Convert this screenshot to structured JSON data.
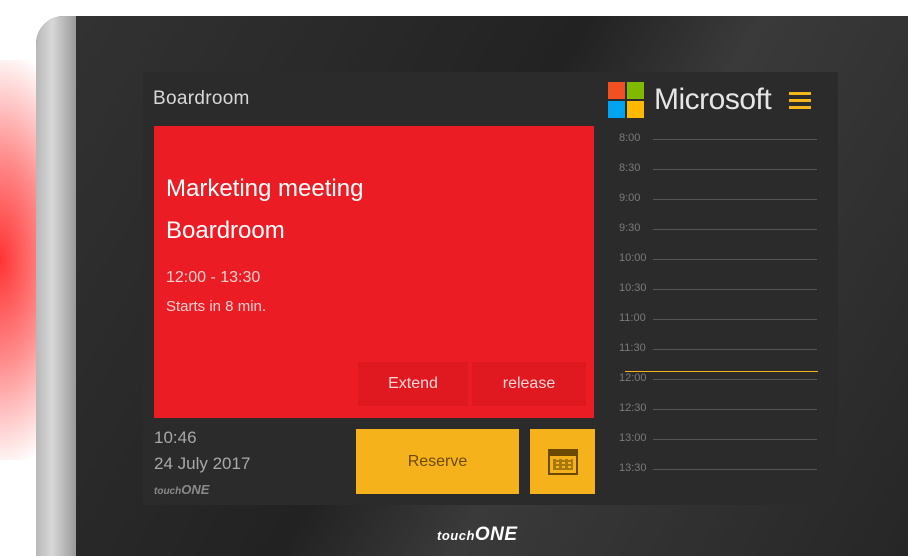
{
  "room": {
    "title": "Boardroom"
  },
  "brand": {
    "name": "Microsoft",
    "logo_colors": [
      "#f25022",
      "#7fba00",
      "#00a4ef",
      "#ffb900"
    ],
    "menu_icon": "hamburger-icon"
  },
  "meeting": {
    "title": "Marketing meeting",
    "location": "Boardroom",
    "time_range": "12:00 - 13:30",
    "starts_in": "Starts in 8 min.",
    "extend_label": "Extend",
    "release_label": "release",
    "card_color": "#ec1c24"
  },
  "status": {
    "clock": "10:46",
    "date": "24 July 2017"
  },
  "actions": {
    "reserve_label": "Reserve",
    "calendar_icon": "calendar-icon",
    "accent_color": "#f6b21b"
  },
  "timeline": {
    "slots": [
      "8:00",
      "8:30",
      "9:00",
      "9:30",
      "10:00",
      "10:30",
      "11:00",
      "11:30",
      "12:00",
      "12:30",
      "13:00",
      "13:30"
    ]
  },
  "device": {
    "logo_prefix": "touch",
    "logo_suffix": "ONE"
  }
}
